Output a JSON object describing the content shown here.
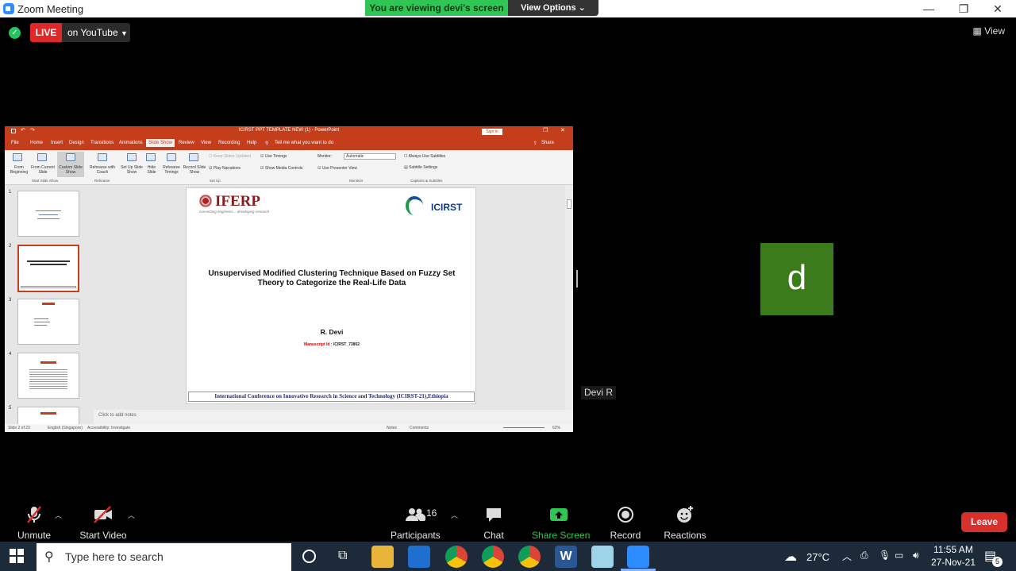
{
  "window": {
    "title": "Zoom Meeting",
    "minimize": "—",
    "restore": "❐",
    "close": "✕"
  },
  "share_banner": {
    "text": "You are viewing devi's screen",
    "view_options": "View Options"
  },
  "meeting_bar": {
    "live_label": "LIVE",
    "stream_target": "on YouTube",
    "view_label": "View"
  },
  "ppt": {
    "window_title": "ICIRST PPT TEMPLATE NEW (1)  -  PowerPoint",
    "sign_in": "Sign in",
    "tabs": [
      "File",
      "Home",
      "Insert",
      "Design",
      "Transitions",
      "Animations",
      "Slide Show",
      "Review",
      "View",
      "Recording",
      "Help"
    ],
    "tell_me": "Tell me what you want to do",
    "share": "Share",
    "ribbon": {
      "from_beginning": "From Beginning",
      "from_current": "From Current Slide",
      "custom_show": "Custom Slide Show",
      "rehearse_coach": "Rehearse with Coach",
      "set_up": "Set Up Slide Show",
      "hide_slide": "Hide Slide",
      "rehearse_timings": "Rehearse Timings",
      "record_show": "Record Slide Show",
      "keep_updated": "Keep Slides Updated",
      "play_narrations": "Play Narrations",
      "use_timings": "Use Timings",
      "show_media_controls": "Show Media Controls",
      "monitor_label": "Monitor:",
      "monitor_value": "Automatic",
      "presenter_view": "Use Presenter View",
      "always_subtitles": "Always Use Subtitles",
      "subtitle_settings": "Subtitle Settings",
      "group_start": "Start Slide Show",
      "group_rehearse": "Rehearse",
      "group_setup": "Set Up",
      "group_monitors": "Monitors",
      "group_captions": "Captions & Subtitles"
    },
    "thumbnails": [
      "1",
      "2",
      "3",
      "4",
      "5"
    ],
    "slide": {
      "logo_left": "IFERP",
      "logo_tagline": "connecting engineers... developing research",
      "logo_right": "ICIRST",
      "title": "Unsupervised Modified Clustering Technique Based on Fuzzy Set Theory to Categorize the Real-Life Data",
      "author": "R. Devi",
      "manuscript_label": "Manuscript Id :",
      "manuscript_id": "ICIRST_73862",
      "footer": "International Conference on Innovative Research in Science and Technology (ICIRST-21),Ethiopia"
    },
    "notes_placeholder": "Click to add notes",
    "status": {
      "slide_count": "Slide 2 of 23",
      "language": "English (Singapore)",
      "accessibility": "Accessibility: Investigate",
      "notes": "Notes",
      "comments": "Comments",
      "zoom": "62%"
    }
  },
  "participant": {
    "initial": "d",
    "name": "Devi R"
  },
  "toolbar": {
    "unmute": "Unmute",
    "start_video": "Start Video",
    "participants": "Participants",
    "participant_count": "16",
    "chat": "Chat",
    "share_screen": "Share Screen",
    "record": "Record",
    "reactions": "Reactions",
    "leave": "Leave"
  },
  "taskbar": {
    "search_placeholder": "Type here to search",
    "temperature": "27°C",
    "time": "11:55 AM",
    "date": "27-Nov-21",
    "notification_count": "5"
  }
}
